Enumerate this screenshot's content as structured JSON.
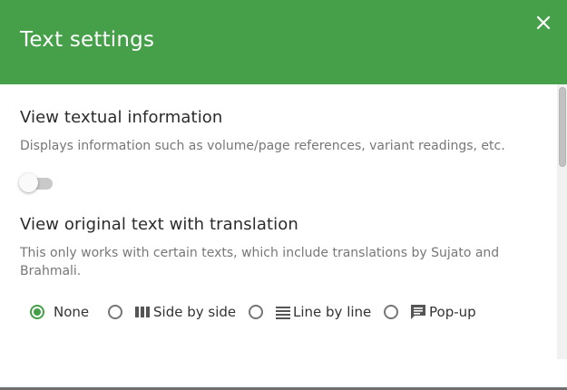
{
  "dialog": {
    "title": "Text settings",
    "accent_color": "#45a049",
    "close_icon": "close-icon"
  },
  "textual_info": {
    "heading": "View textual information",
    "description": "Displays information such as volume/page references, variant readings, etc.",
    "toggle_on": false
  },
  "original_text": {
    "heading": "View original text with translation",
    "description": "This only works with certain texts, which include translations by Sujato and Brahmali.",
    "selected": "None",
    "options": [
      {
        "label": "None",
        "icon": null,
        "checked": true
      },
      {
        "label": "Side by side",
        "icon": "columns-icon",
        "checked": false
      },
      {
        "label": "Line by line",
        "icon": "lines-icon",
        "checked": false
      },
      {
        "label": "Pop-up",
        "icon": "comment-icon",
        "checked": false
      }
    ]
  }
}
